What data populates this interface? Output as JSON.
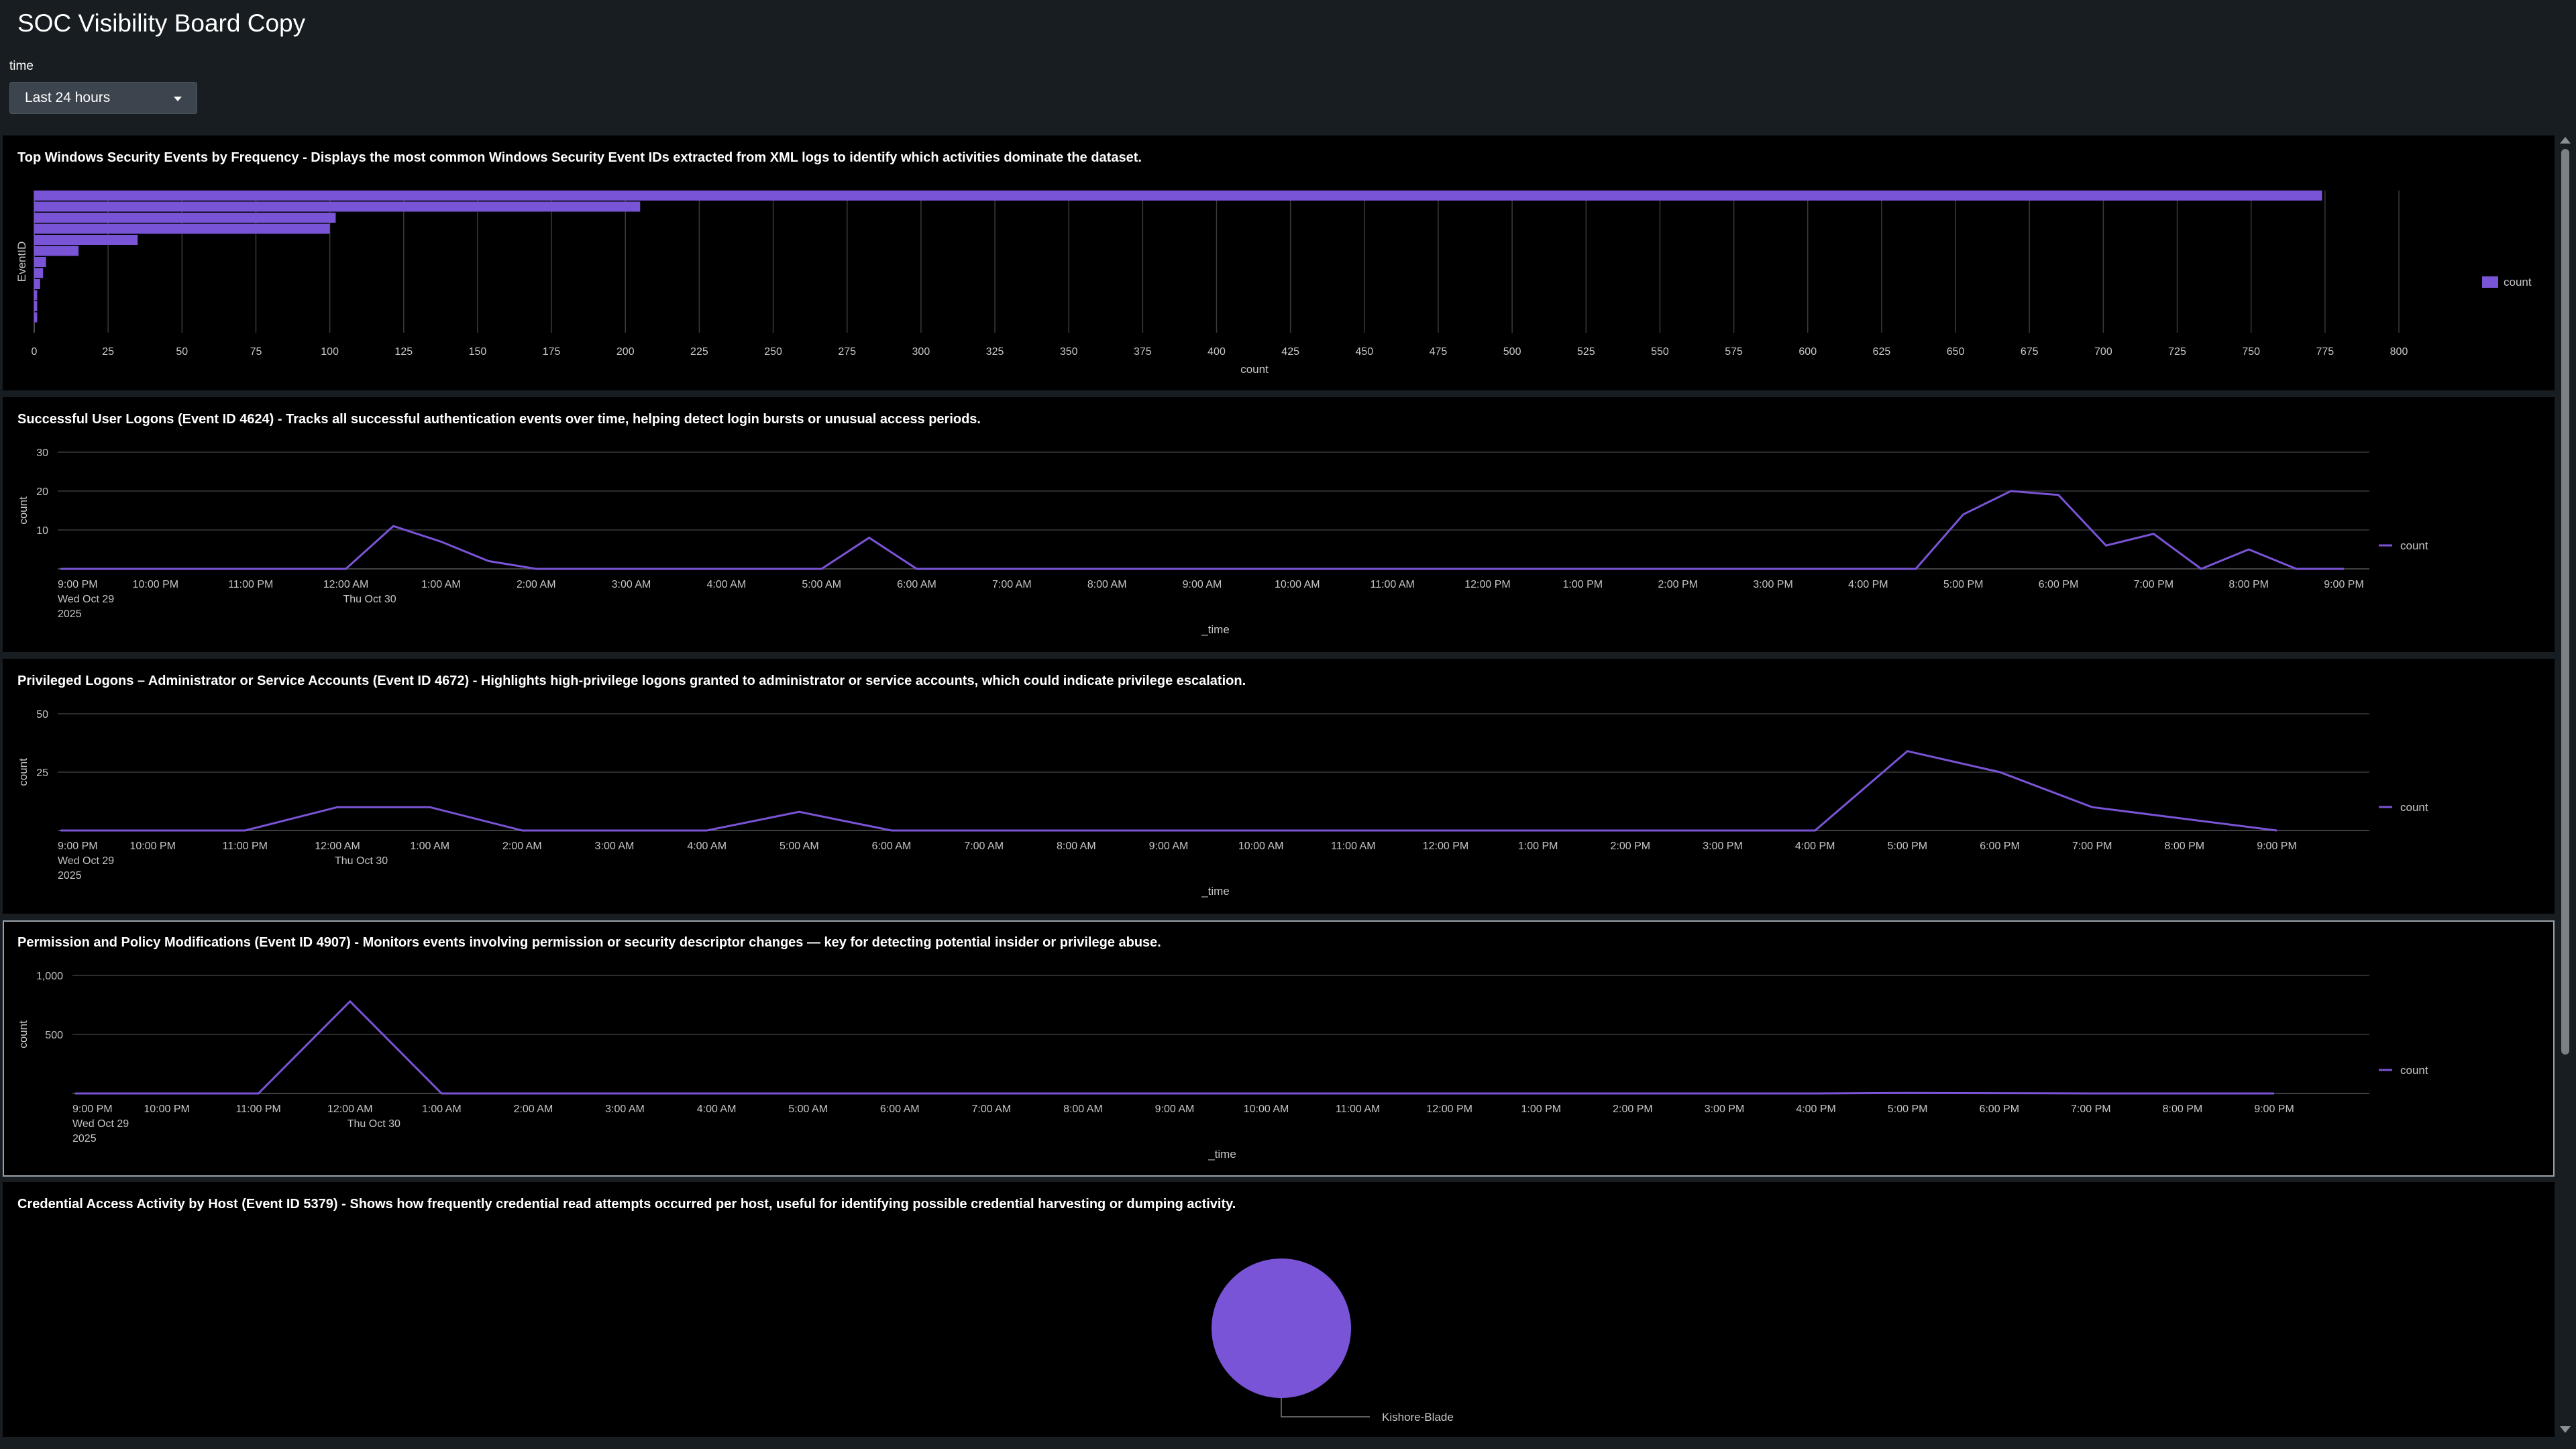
{
  "dashboard": {
    "title": "SOC Visibility Board Copy"
  },
  "time_input": {
    "label": "time",
    "value": "Last 24 hours"
  },
  "colors": {
    "accent": "#7a54d6",
    "grid": "#3a3a3a",
    "axis_text": "#c6c6c6"
  },
  "panels": [
    {
      "title": "Top Windows Security Events by Frequency - Displays the most common Windows Security Event IDs extracted from XML logs to identify which activities dominate the dataset."
    },
    {
      "title": "Successful User Logons (Event ID 4624) - Tracks all successful authentication events over time, helping detect login bursts or unusual access periods."
    },
    {
      "title": "Privileged Logons – Administrator or Service Accounts (Event ID 4672) - Highlights high-privilege logons granted to administrator or service accounts, which could indicate privilege escalation."
    },
    {
      "title": "Permission and Policy Modifications (Event ID 4907) - Monitors events involving permission or security descriptor changes — key for detecting potential insider or privilege abuse."
    },
    {
      "title": "Credential Access Activity by Host (Event ID 5379) - Shows how frequently credential read attempts occurred per host, useful for identifying possible credential harvesting or dumping activity."
    }
  ],
  "chart_data": [
    {
      "type": "bar",
      "orientation": "horizontal",
      "ylabel": "EventID",
      "xlabel": "count",
      "xlim": [
        0,
        800
      ],
      "xticks": [
        "0",
        "25",
        "50",
        "75",
        "100",
        "125",
        "150",
        "175",
        "200",
        "225",
        "250",
        "275",
        "300",
        "325",
        "350",
        "375",
        "400",
        "425",
        "450",
        "475",
        "500",
        "525",
        "550",
        "575",
        "600",
        "625",
        "650",
        "675",
        "700",
        "725",
        "750",
        "775",
        "800"
      ],
      "values": [
        774,
        205,
        102,
        100,
        35,
        15,
        4,
        3,
        2,
        1,
        1,
        1
      ],
      "series": [
        {
          "name": "count"
        }
      ],
      "legend": "right"
    },
    {
      "type": "line",
      "xlabel": "_time",
      "ylabel": "count",
      "ylim": [
        0,
        30
      ],
      "yticks": [
        "30",
        "20",
        "10"
      ],
      "xticks": [
        "9:00 PM",
        "10:00 PM",
        "11:00 PM",
        "12:00 AM",
        "1:00 AM",
        "2:00 AM",
        "3:00 AM",
        "4:00 AM",
        "5:00 AM",
        "6:00 AM",
        "7:00 AM",
        "8:00 AM",
        "9:00 AM",
        "10:00 AM",
        "11:00 AM",
        "12:00 PM",
        "1:00 PM",
        "2:00 PM",
        "3:00 PM",
        "4:00 PM",
        "5:00 PM",
        "6:00 PM",
        "7:00 PM",
        "8:00 PM",
        "9:00 PM"
      ],
      "xtick_sub": {
        "first": [
          "Wed Oct 29",
          "2025"
        ],
        "midnight": [
          "Thu Oct 30"
        ]
      },
      "x": [
        "9:00 PM",
        "9:30 PM",
        "10:00 PM",
        "10:30 PM",
        "11:00 PM",
        "11:30 PM",
        "12:00 AM",
        "12:30 AM",
        "1:00 AM",
        "1:30 AM",
        "2:00 AM",
        "2:30 AM",
        "3:00 AM",
        "3:30 AM",
        "4:00 AM",
        "4:30 AM",
        "5:00 AM",
        "5:30 AM",
        "6:00 AM",
        "6:30 AM",
        "7:00 AM",
        "7:30 AM",
        "8:00 AM",
        "8:30 AM",
        "9:00 AM",
        "9:30 AM",
        "10:00 AM",
        "10:30 AM",
        "11:00 AM",
        "11:30 AM",
        "12:00 PM",
        "12:30 PM",
        "1:00 PM",
        "1:30 PM",
        "2:00 PM",
        "2:30 PM",
        "3:00 PM",
        "3:30 PM",
        "4:00 PM",
        "4:30 PM",
        "5:00 PM",
        "5:30 PM",
        "6:00 PM",
        "6:30 PM",
        "7:00 PM",
        "7:30 PM",
        "8:00 PM",
        "8:30 PM",
        "9:00 PM"
      ],
      "series": [
        {
          "name": "count",
          "values": [
            0,
            0,
            0,
            0,
            0,
            0,
            0,
            11,
            7,
            2,
            0,
            0,
            0,
            0,
            0,
            0,
            0,
            8,
            0,
            0,
            0,
            0,
            0,
            0,
            0,
            0,
            0,
            0,
            0,
            0,
            0,
            0,
            0,
            0,
            0,
            0,
            0,
            0,
            0,
            0,
            14,
            20,
            19,
            6,
            9,
            0,
            5,
            0,
            0
          ]
        }
      ],
      "legend": "right"
    },
    {
      "type": "line",
      "xlabel": "_time",
      "ylabel": "count",
      "ylim": [
        0,
        50
      ],
      "yticks": [
        "50",
        "25"
      ],
      "xticks": [
        "9:00 PM",
        "10:00 PM",
        "11:00 PM",
        "12:00 AM",
        "1:00 AM",
        "2:00 AM",
        "3:00 AM",
        "4:00 AM",
        "5:00 AM",
        "6:00 AM",
        "7:00 AM",
        "8:00 AM",
        "9:00 AM",
        "10:00 AM",
        "11:00 AM",
        "12:00 PM",
        "1:00 PM",
        "2:00 PM",
        "3:00 PM",
        "4:00 PM",
        "5:00 PM",
        "6:00 PM",
        "7:00 PM",
        "8:00 PM",
        "9:00 PM"
      ],
      "xtick_sub": {
        "first": [
          "Wed Oct 29",
          "2025"
        ],
        "midnight": [
          "Thu Oct 30"
        ]
      },
      "x": [
        "9:00 PM",
        "10:00 PM",
        "11:00 PM",
        "12:00 AM",
        "1:00 AM",
        "2:00 AM",
        "3:00 AM",
        "4:00 AM",
        "5:00 AM",
        "6:00 AM",
        "7:00 AM",
        "8:00 AM",
        "9:00 AM",
        "10:00 AM",
        "11:00 AM",
        "12:00 PM",
        "1:00 PM",
        "2:00 PM",
        "3:00 PM",
        "4:00 PM",
        "5:00 PM",
        "6:00 PM",
        "7:00 PM",
        "8:00 PM",
        "9:00 PM"
      ],
      "series": [
        {
          "name": "count",
          "values": [
            0,
            0,
            0,
            10,
            10,
            0,
            0,
            0,
            8,
            0,
            0,
            0,
            0,
            0,
            0,
            0,
            0,
            0,
            0,
            0,
            34,
            25,
            10,
            5,
            0
          ]
        }
      ],
      "legend": "right"
    },
    {
      "type": "line",
      "xlabel": "_time",
      "ylabel": "count",
      "ylim": [
        0,
        1000
      ],
      "yticks": [
        "1,000",
        "500"
      ],
      "xticks": [
        "9:00 PM",
        "10:00 PM",
        "11:00 PM",
        "12:00 AM",
        "1:00 AM",
        "2:00 AM",
        "3:00 AM",
        "4:00 AM",
        "5:00 AM",
        "6:00 AM",
        "7:00 AM",
        "8:00 AM",
        "9:00 AM",
        "10:00 AM",
        "11:00 AM",
        "12:00 PM",
        "1:00 PM",
        "2:00 PM",
        "3:00 PM",
        "4:00 PM",
        "5:00 PM",
        "6:00 PM",
        "7:00 PM",
        "8:00 PM",
        "9:00 PM"
      ],
      "xtick_sub": {
        "first": [
          "Wed Oct 29",
          "2025"
        ],
        "midnight": [
          "Thu Oct 30"
        ]
      },
      "x": [
        "9:00 PM",
        "10:00 PM",
        "11:00 PM",
        "12:00 AM",
        "1:00 AM",
        "2:00 AM",
        "3:00 AM",
        "4:00 AM",
        "5:00 AM",
        "6:00 AM",
        "7:00 AM",
        "8:00 AM",
        "9:00 AM",
        "10:00 AM",
        "11:00 AM",
        "12:00 PM",
        "1:00 PM",
        "2:00 PM",
        "3:00 PM",
        "4:00 PM",
        "5:00 PM",
        "6:00 PM",
        "7:00 PM",
        "8:00 PM",
        "9:00 PM"
      ],
      "series": [
        {
          "name": "count",
          "values": [
            0,
            0,
            0,
            780,
            0,
            0,
            0,
            0,
            0,
            0,
            0,
            0,
            0,
            0,
            0,
            0,
            0,
            0,
            0,
            0,
            4,
            2,
            0,
            0,
            0
          ]
        }
      ],
      "legend": "right"
    },
    {
      "type": "pie",
      "slices": [
        {
          "label": "Kishore-Blade",
          "value": 1
        }
      ]
    }
  ]
}
